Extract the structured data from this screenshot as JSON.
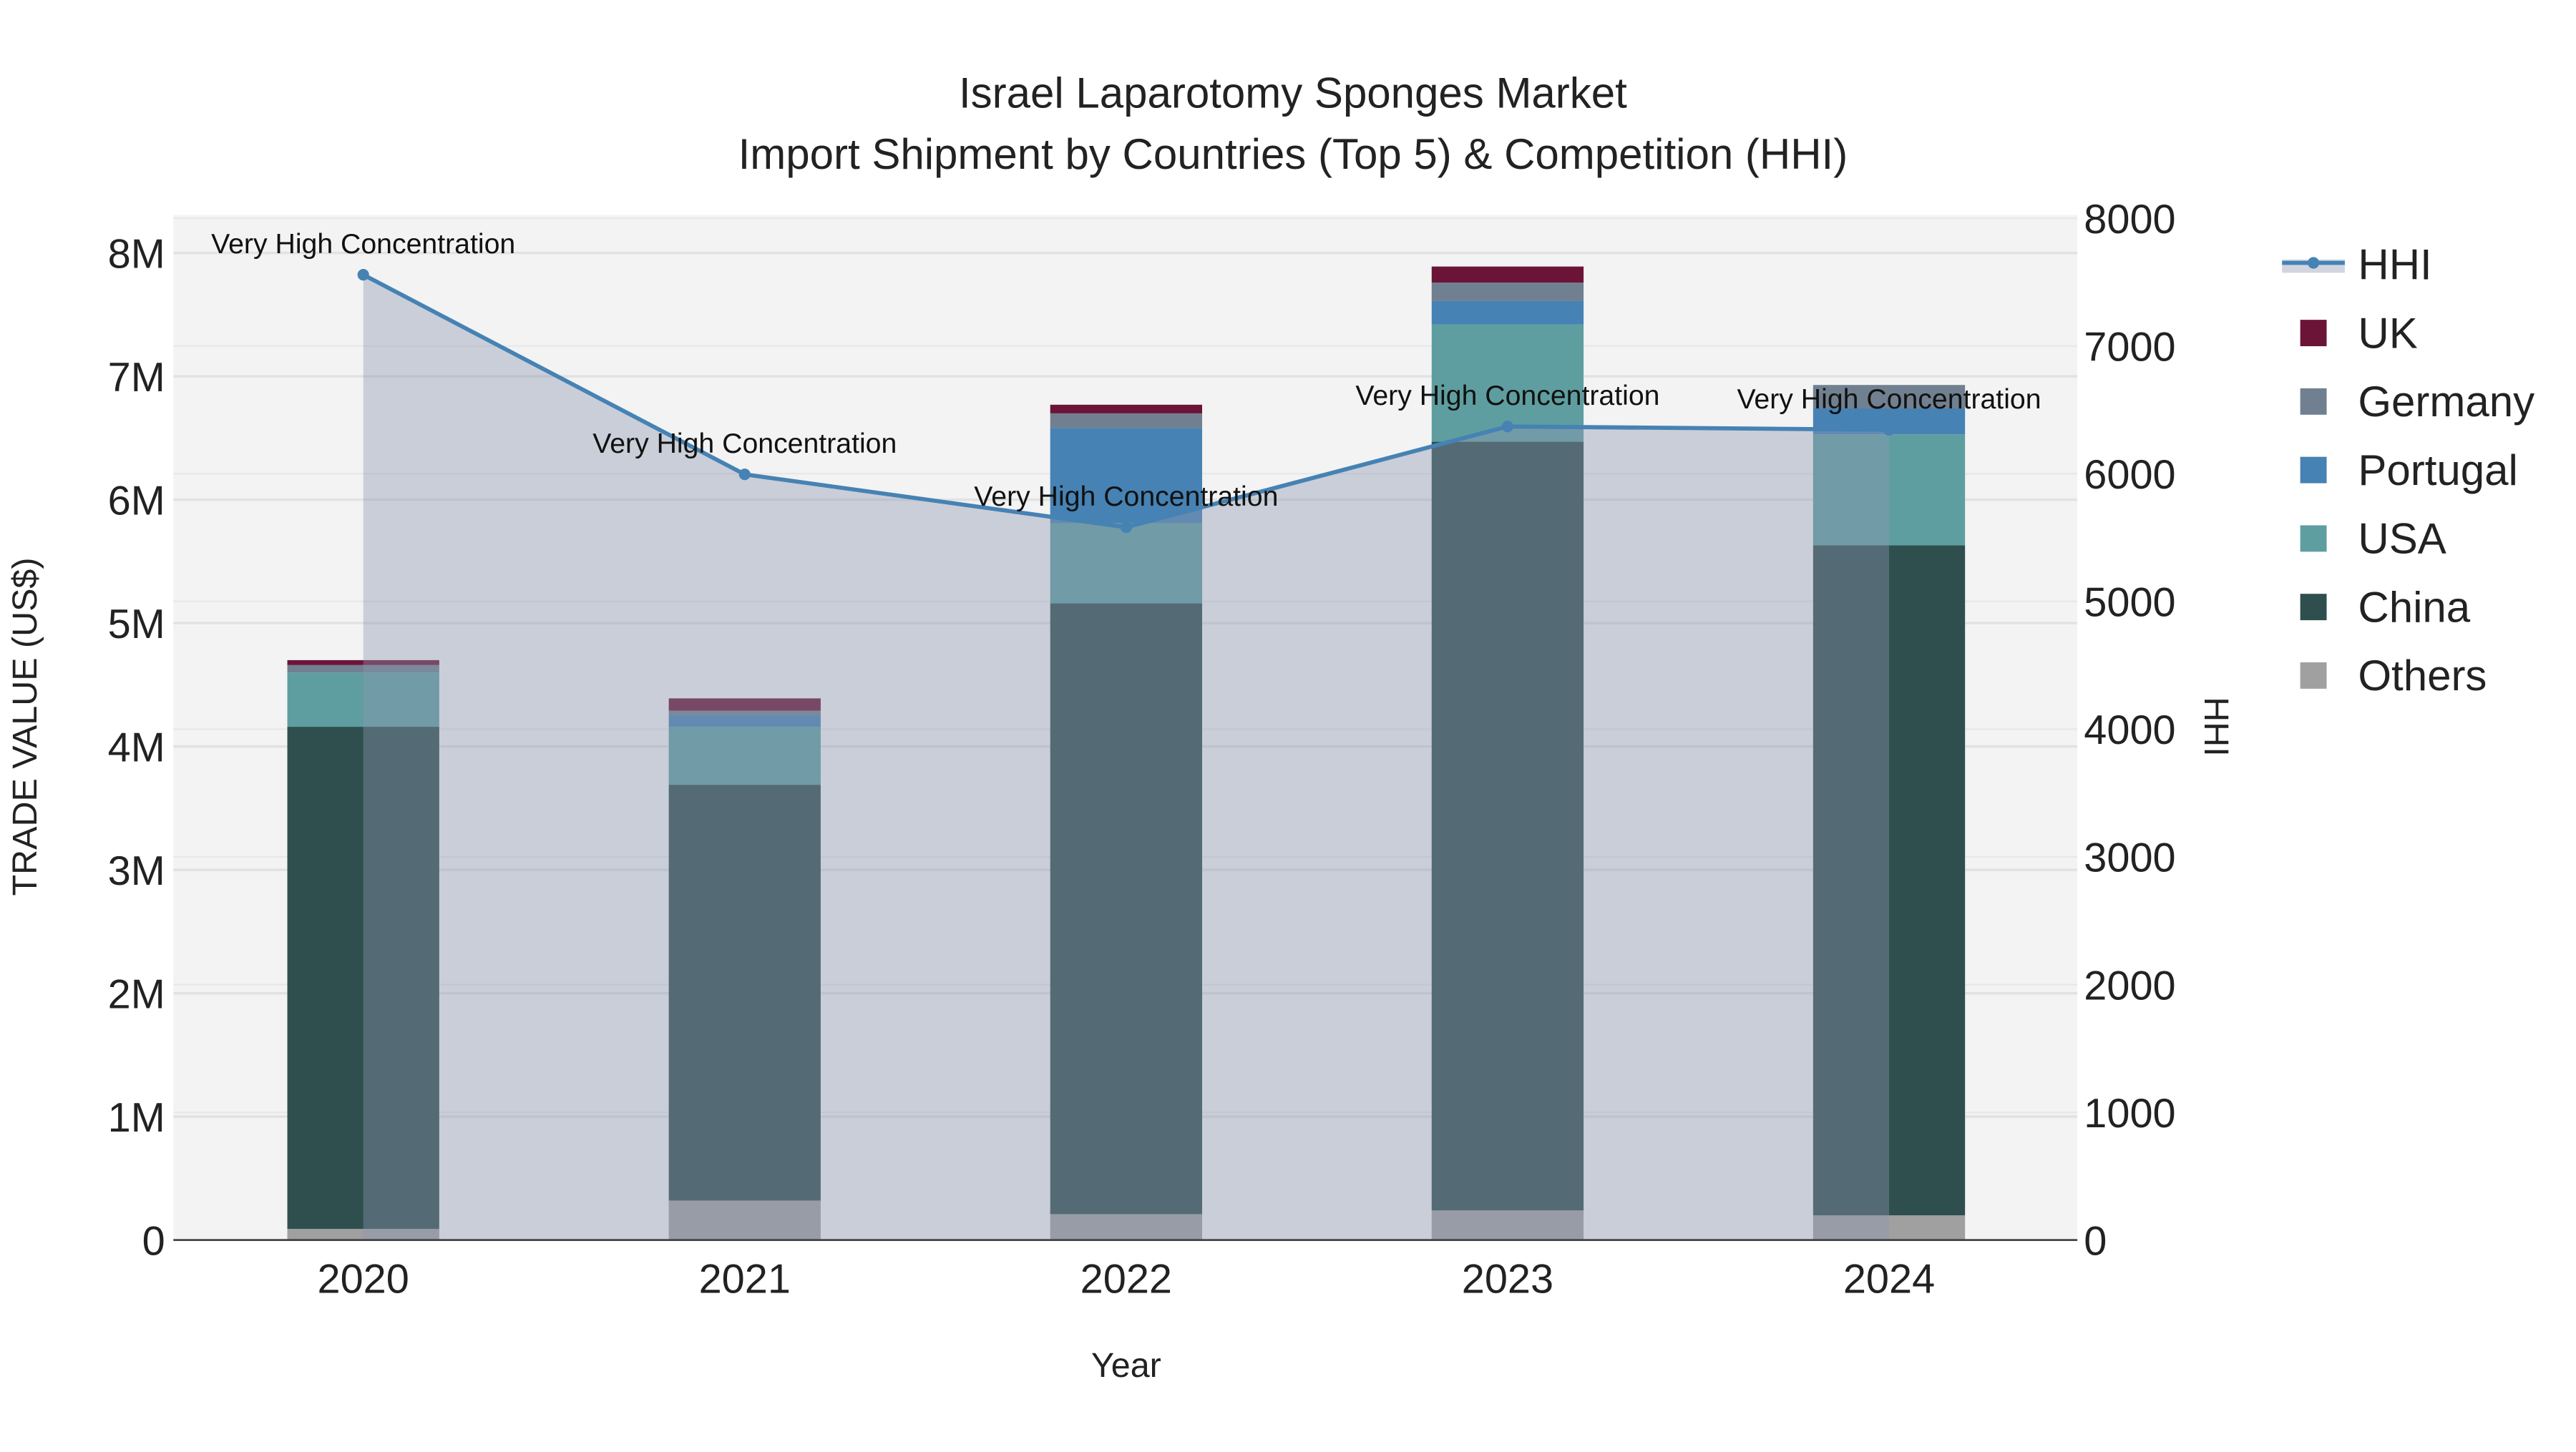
{
  "chart_data": {
    "type": "bar",
    "title": "Israel Laparotomy Sponges Market",
    "subtitle": "Import Shipment by Countries (Top 5) & Competition (HHI)",
    "xlabel": "Year",
    "ylabel": "TRADE VALUE (US$)",
    "y2label": "HHI",
    "categories": [
      "2020",
      "2021",
      "2022",
      "2023",
      "2024"
    ],
    "ylim": [
      0,
      8300000
    ],
    "y2lim": [
      0,
      8000
    ],
    "yticks": [
      {
        "v": 0,
        "label": "0"
      },
      {
        "v": 1000000,
        "label": "1M"
      },
      {
        "v": 2000000,
        "label": "2M"
      },
      {
        "v": 3000000,
        "label": "3M"
      },
      {
        "v": 4000000,
        "label": "4M"
      },
      {
        "v": 5000000,
        "label": "5M"
      },
      {
        "v": 6000000,
        "label": "6M"
      },
      {
        "v": 7000000,
        "label": "7M"
      },
      {
        "v": 8000000,
        "label": "8M"
      }
    ],
    "y2ticks": [
      "0",
      "1000",
      "2000",
      "3000",
      "4000",
      "5000",
      "6000",
      "7000",
      "8000"
    ],
    "stacked": true,
    "series": [
      {
        "name": "Others",
        "color": "#a0a0a0",
        "values": [
          90000,
          320000,
          210000,
          240000,
          200000
        ]
      },
      {
        "name": "China",
        "color": "#2f4f4f",
        "values": [
          4070000,
          3370000,
          4950000,
          6230000,
          5430000
        ]
      },
      {
        "name": "USA",
        "color": "#5f9ea0",
        "values": [
          440000,
          470000,
          650000,
          950000,
          900000
        ]
      },
      {
        "name": "Portugal",
        "color": "#4682b4",
        "values": [
          0,
          90000,
          770000,
          190000,
          210000
        ]
      },
      {
        "name": "Germany",
        "color": "#708090",
        "values": [
          60000,
          40000,
          120000,
          150000,
          190000
        ]
      },
      {
        "name": "UK",
        "color": "#6b1438",
        "values": [
          40000,
          100000,
          70000,
          130000,
          0
        ]
      }
    ],
    "line": {
      "name": "HHI",
      "color": "#4682b4",
      "axis": "right",
      "values": [
        7558,
        5995,
        5581,
        6370,
        6344
      ],
      "annotations": [
        "Very High Concentration",
        "Very High Concentration",
        "Very High Concentration",
        "Very High Concentration",
        "Very High Concentration"
      ]
    },
    "legend": {
      "placement": "right",
      "items": [
        "HHI",
        "UK",
        "Germany",
        "Portugal",
        "USA",
        "China",
        "Others"
      ]
    },
    "grid": true
  }
}
